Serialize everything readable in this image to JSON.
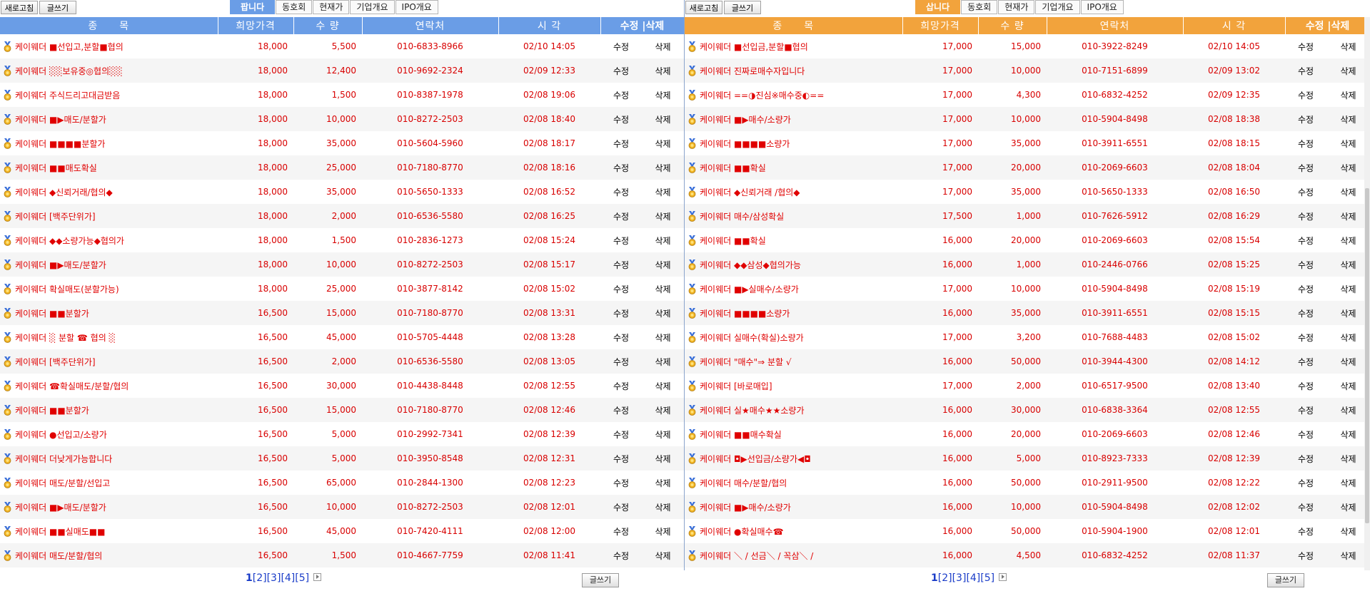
{
  "sell": {
    "refresh_label": "새로고침",
    "write_label": "글쓰기",
    "tabs": [
      "팝니다",
      "동호회",
      "현재가",
      "기업개요",
      "IPO개요"
    ],
    "headers": {
      "title": "종　　목",
      "price": "희망가격",
      "qty": "수 량",
      "phone": "연락처",
      "time": "시 각",
      "edit_delete": "수정 |삭제"
    },
    "edit_label": "수정",
    "delete_label": "삭제",
    "rows": [
      {
        "title": "케이웨더 ■선입고,분할■협의",
        "price": "18,000",
        "qty": "5,500",
        "phone": "010-6833-8966",
        "time": "02/10 14:05"
      },
      {
        "title": "케이웨더 ░░보유중◎협의░░",
        "price": "18,000",
        "qty": "12,400",
        "phone": "010-9692-2324",
        "time": "02/09 12:33"
      },
      {
        "title": "케이웨더 주식드리고대금받음",
        "price": "18,000",
        "qty": "1,500",
        "phone": "010-8387-1978",
        "time": "02/08 19:06"
      },
      {
        "title": "케이웨더 ■▶매도/분할가",
        "price": "18,000",
        "qty": "10,000",
        "phone": "010-8272-2503",
        "time": "02/08 18:40"
      },
      {
        "title": "케이웨더 ■■■■분할가",
        "price": "18,000",
        "qty": "35,000",
        "phone": "010-5604-5960",
        "time": "02/08 18:17"
      },
      {
        "title": "케이웨더 ■■매도확실",
        "price": "18,000",
        "qty": "25,000",
        "phone": "010-7180-8770",
        "time": "02/08 18:16"
      },
      {
        "title": "케이웨더 ◆신뢰거래/협의◆",
        "price": "18,000",
        "qty": "35,000",
        "phone": "010-5650-1333",
        "time": "02/08 16:52"
      },
      {
        "title": "케이웨더 [백주단위가]",
        "price": "18,000",
        "qty": "2,000",
        "phone": "010-6536-5580",
        "time": "02/08 16:25"
      },
      {
        "title": "케이웨더 ◆◆소량가능◆협의가",
        "price": "18,000",
        "qty": "1,500",
        "phone": "010-2836-1273",
        "time": "02/08 15:24"
      },
      {
        "title": "케이웨더 ■▶매도/분할가",
        "price": "18,000",
        "qty": "10,000",
        "phone": "010-8272-2503",
        "time": "02/08 15:17"
      },
      {
        "title": "케이웨더 확실매도(분할가능)",
        "price": "18,000",
        "qty": "25,000",
        "phone": "010-3877-8142",
        "time": "02/08 15:02"
      },
      {
        "title": "케이웨더 ■■분할가",
        "price": "16,500",
        "qty": "15,000",
        "phone": "010-7180-8770",
        "time": "02/08 13:31"
      },
      {
        "title": "케이웨더 ░ 분할 ☎ 협의 ░",
        "price": "16,500",
        "qty": "45,000",
        "phone": "010-5705-4448",
        "time": "02/08 13:28"
      },
      {
        "title": "케이웨더 [백주단위가]",
        "price": "16,500",
        "qty": "2,000",
        "phone": "010-6536-5580",
        "time": "02/08 13:05"
      },
      {
        "title": "케이웨더 ☎확실매도/분할/협의",
        "price": "16,500",
        "qty": "30,000",
        "phone": "010-4438-8448",
        "time": "02/08 12:55"
      },
      {
        "title": "케이웨더 ■■분할가",
        "price": "16,500",
        "qty": "15,000",
        "phone": "010-7180-8770",
        "time": "02/08 12:46"
      },
      {
        "title": "케이웨더 ●선입고/소량가",
        "price": "16,500",
        "qty": "5,000",
        "phone": "010-2992-7341",
        "time": "02/08 12:39"
      },
      {
        "title": "케이웨더 더낮게가능합니다",
        "price": "16,500",
        "qty": "5,000",
        "phone": "010-3950-8548",
        "time": "02/08 12:31"
      },
      {
        "title": "케이웨더 매도/분할/선입고",
        "price": "16,500",
        "qty": "65,000",
        "phone": "010-2844-1300",
        "time": "02/08 12:23"
      },
      {
        "title": "케이웨더 ■▶매도/분할가",
        "price": "16,500",
        "qty": "10,000",
        "phone": "010-8272-2503",
        "time": "02/08 12:01"
      },
      {
        "title": "케이웨더 ■■실매도■■",
        "price": "16,500",
        "qty": "45,000",
        "phone": "010-7420-4111",
        "time": "02/08 12:00"
      },
      {
        "title": "케이웨더 매도/분할/협의",
        "price": "16,500",
        "qty": "1,500",
        "phone": "010-4667-7759",
        "time": "02/08 11:41"
      }
    ],
    "pager": {
      "current": "1",
      "pages": [
        "[2]",
        "[3]",
        "[4]",
        "[5]"
      ]
    },
    "bottom_write_label": "글쓰기"
  },
  "buy": {
    "refresh_label": "새로고침",
    "write_label": "글쓰기",
    "tabs": [
      "삽니다",
      "동호회",
      "현재가",
      "기업개요",
      "IPO개요"
    ],
    "headers": {
      "title": "종　　목",
      "price": "희망가격",
      "qty": "수 량",
      "phone": "연락처",
      "time": "시 각",
      "edit_delete": "수정 |삭제"
    },
    "edit_label": "수정",
    "delete_label": "삭제",
    "rows": [
      {
        "title": "케이웨더 ■선입금,분할■협의",
        "price": "17,000",
        "qty": "15,000",
        "phone": "010-3922-8249",
        "time": "02/10 14:05"
      },
      {
        "title": "케이웨더 진짜로매수자입니다",
        "price": "17,000",
        "qty": "10,000",
        "phone": "010-7151-6899",
        "time": "02/09 13:02"
      },
      {
        "title": "케이웨더 ==◑진심※매수중◐==",
        "price": "17,000",
        "qty": "4,300",
        "phone": "010-6832-4252",
        "time": "02/09 12:35"
      },
      {
        "title": "케이웨더 ■▶매수/소량가",
        "price": "17,000",
        "qty": "10,000",
        "phone": "010-5904-8498",
        "time": "02/08 18:38"
      },
      {
        "title": "케이웨더 ■■■■소량가",
        "price": "17,000",
        "qty": "35,000",
        "phone": "010-3911-6551",
        "time": "02/08 18:15"
      },
      {
        "title": "케이웨더 ■■확실",
        "price": "17,000",
        "qty": "20,000",
        "phone": "010-2069-6603",
        "time": "02/08 18:04"
      },
      {
        "title": "케이웨더 ◆신뢰거래 /협의◆",
        "price": "17,000",
        "qty": "35,000",
        "phone": "010-5650-1333",
        "time": "02/08 16:50"
      },
      {
        "title": "케이웨더 매수/삼성확실",
        "price": "17,500",
        "qty": "1,000",
        "phone": "010-7626-5912",
        "time": "02/08 16:29"
      },
      {
        "title": "케이웨더 ■■확실",
        "price": "16,000",
        "qty": "20,000",
        "phone": "010-2069-6603",
        "time": "02/08 15:54"
      },
      {
        "title": "케이웨더 ◆◆삼성◆협의가능",
        "price": "16,000",
        "qty": "1,000",
        "phone": "010-2446-0766",
        "time": "02/08 15:25"
      },
      {
        "title": "케이웨더 ■▶실매수/소량가",
        "price": "17,000",
        "qty": "10,000",
        "phone": "010-5904-8498",
        "time": "02/08 15:19"
      },
      {
        "title": "케이웨더 ■■■■소량가",
        "price": "16,000",
        "qty": "35,000",
        "phone": "010-3911-6551",
        "time": "02/08 15:15"
      },
      {
        "title": "케이웨더 실매수(확실)소량가",
        "price": "17,000",
        "qty": "3,200",
        "phone": "010-7688-4483",
        "time": "02/08 15:02"
      },
      {
        "title": "케이웨더 \"매수\"⇒ 분할 √",
        "price": "16,000",
        "qty": "50,000",
        "phone": "010-3944-4300",
        "time": "02/08 14:12"
      },
      {
        "title": "케이웨더 [바로매입]",
        "price": "17,000",
        "qty": "2,000",
        "phone": "010-6517-9500",
        "time": "02/08 13:40"
      },
      {
        "title": "케이웨더 실★매수★★소량가",
        "price": "16,000",
        "qty": "30,000",
        "phone": "010-6838-3364",
        "time": "02/08 12:55"
      },
      {
        "title": "케이웨더 ■■매수확실",
        "price": "16,000",
        "qty": "20,000",
        "phone": "010-2069-6603",
        "time": "02/08 12:46"
      },
      {
        "title": "케이웨더 ◘▶선입금/소량가◀◘",
        "price": "16,000",
        "qty": "5,000",
        "phone": "010-8923-7333",
        "time": "02/08 12:39"
      },
      {
        "title": "케이웨더 매수/분할/협의",
        "price": "16,000",
        "qty": "50,000",
        "phone": "010-2911-9500",
        "time": "02/08 12:22"
      },
      {
        "title": "케이웨더 ■▶매수/소량가",
        "price": "16,000",
        "qty": "10,000",
        "phone": "010-5904-8498",
        "time": "02/08 12:02"
      },
      {
        "title": "케이웨더 ●확실매수☎",
        "price": "16,000",
        "qty": "50,000",
        "phone": "010-5904-1900",
        "time": "02/08 12:01"
      },
      {
        "title": "케이웨더 ＼ / 선금＼ / 꼭삼＼ /",
        "price": "16,000",
        "qty": "4,500",
        "phone": "010-6832-4252",
        "time": "02/08 11:37"
      }
    ],
    "pager": {
      "current": "1",
      "pages": [
        "[2]",
        "[3]",
        "[4]",
        "[5]"
      ]
    },
    "bottom_write_label": "글쓰기"
  },
  "icons": {
    "row_icon": "medal-icon",
    "next_page_icon": "next-arrow-icon"
  },
  "colors": {
    "sell_header": "#6a9de6",
    "buy_header": "#f2a33c",
    "listing_text": "#e00000",
    "pager_link": "#1a3cc8"
  }
}
